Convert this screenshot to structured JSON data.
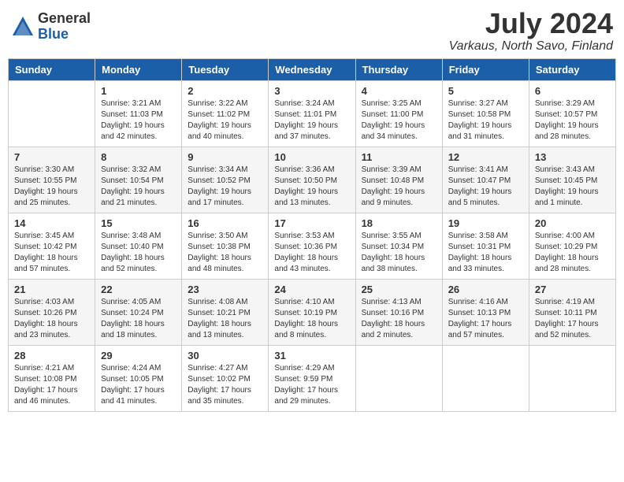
{
  "logo": {
    "general": "General",
    "blue": "Blue"
  },
  "title": {
    "month_year": "July 2024",
    "location": "Varkaus, North Savo, Finland"
  },
  "days_of_week": [
    "Sunday",
    "Monday",
    "Tuesday",
    "Wednesday",
    "Thursday",
    "Friday",
    "Saturday"
  ],
  "weeks": [
    [
      {
        "day": "",
        "detail": ""
      },
      {
        "day": "1",
        "detail": "Sunrise: 3:21 AM\nSunset: 11:03 PM\nDaylight: 19 hours\nand 42 minutes."
      },
      {
        "day": "2",
        "detail": "Sunrise: 3:22 AM\nSunset: 11:02 PM\nDaylight: 19 hours\nand 40 minutes."
      },
      {
        "day": "3",
        "detail": "Sunrise: 3:24 AM\nSunset: 11:01 PM\nDaylight: 19 hours\nand 37 minutes."
      },
      {
        "day": "4",
        "detail": "Sunrise: 3:25 AM\nSunset: 11:00 PM\nDaylight: 19 hours\nand 34 minutes."
      },
      {
        "day": "5",
        "detail": "Sunrise: 3:27 AM\nSunset: 10:58 PM\nDaylight: 19 hours\nand 31 minutes."
      },
      {
        "day": "6",
        "detail": "Sunrise: 3:29 AM\nSunset: 10:57 PM\nDaylight: 19 hours\nand 28 minutes."
      }
    ],
    [
      {
        "day": "7",
        "detail": "Sunrise: 3:30 AM\nSunset: 10:55 PM\nDaylight: 19 hours\nand 25 minutes."
      },
      {
        "day": "8",
        "detail": "Sunrise: 3:32 AM\nSunset: 10:54 PM\nDaylight: 19 hours\nand 21 minutes."
      },
      {
        "day": "9",
        "detail": "Sunrise: 3:34 AM\nSunset: 10:52 PM\nDaylight: 19 hours\nand 17 minutes."
      },
      {
        "day": "10",
        "detail": "Sunrise: 3:36 AM\nSunset: 10:50 PM\nDaylight: 19 hours\nand 13 minutes."
      },
      {
        "day": "11",
        "detail": "Sunrise: 3:39 AM\nSunset: 10:48 PM\nDaylight: 19 hours\nand 9 minutes."
      },
      {
        "day": "12",
        "detail": "Sunrise: 3:41 AM\nSunset: 10:47 PM\nDaylight: 19 hours\nand 5 minutes."
      },
      {
        "day": "13",
        "detail": "Sunrise: 3:43 AM\nSunset: 10:45 PM\nDaylight: 19 hours\nand 1 minute."
      }
    ],
    [
      {
        "day": "14",
        "detail": "Sunrise: 3:45 AM\nSunset: 10:42 PM\nDaylight: 18 hours\nand 57 minutes."
      },
      {
        "day": "15",
        "detail": "Sunrise: 3:48 AM\nSunset: 10:40 PM\nDaylight: 18 hours\nand 52 minutes."
      },
      {
        "day": "16",
        "detail": "Sunrise: 3:50 AM\nSunset: 10:38 PM\nDaylight: 18 hours\nand 48 minutes."
      },
      {
        "day": "17",
        "detail": "Sunrise: 3:53 AM\nSunset: 10:36 PM\nDaylight: 18 hours\nand 43 minutes."
      },
      {
        "day": "18",
        "detail": "Sunrise: 3:55 AM\nSunset: 10:34 PM\nDaylight: 18 hours\nand 38 minutes."
      },
      {
        "day": "19",
        "detail": "Sunrise: 3:58 AM\nSunset: 10:31 PM\nDaylight: 18 hours\nand 33 minutes."
      },
      {
        "day": "20",
        "detail": "Sunrise: 4:00 AM\nSunset: 10:29 PM\nDaylight: 18 hours\nand 28 minutes."
      }
    ],
    [
      {
        "day": "21",
        "detail": "Sunrise: 4:03 AM\nSunset: 10:26 PM\nDaylight: 18 hours\nand 23 minutes."
      },
      {
        "day": "22",
        "detail": "Sunrise: 4:05 AM\nSunset: 10:24 PM\nDaylight: 18 hours\nand 18 minutes."
      },
      {
        "day": "23",
        "detail": "Sunrise: 4:08 AM\nSunset: 10:21 PM\nDaylight: 18 hours\nand 13 minutes."
      },
      {
        "day": "24",
        "detail": "Sunrise: 4:10 AM\nSunset: 10:19 PM\nDaylight: 18 hours\nand 8 minutes."
      },
      {
        "day": "25",
        "detail": "Sunrise: 4:13 AM\nSunset: 10:16 PM\nDaylight: 18 hours\nand 2 minutes."
      },
      {
        "day": "26",
        "detail": "Sunrise: 4:16 AM\nSunset: 10:13 PM\nDaylight: 17 hours\nand 57 minutes."
      },
      {
        "day": "27",
        "detail": "Sunrise: 4:19 AM\nSunset: 10:11 PM\nDaylight: 17 hours\nand 52 minutes."
      }
    ],
    [
      {
        "day": "28",
        "detail": "Sunrise: 4:21 AM\nSunset: 10:08 PM\nDaylight: 17 hours\nand 46 minutes."
      },
      {
        "day": "29",
        "detail": "Sunrise: 4:24 AM\nSunset: 10:05 PM\nDaylight: 17 hours\nand 41 minutes."
      },
      {
        "day": "30",
        "detail": "Sunrise: 4:27 AM\nSunset: 10:02 PM\nDaylight: 17 hours\nand 35 minutes."
      },
      {
        "day": "31",
        "detail": "Sunrise: 4:29 AM\nSunset: 9:59 PM\nDaylight: 17 hours\nand 29 minutes."
      },
      {
        "day": "",
        "detail": ""
      },
      {
        "day": "",
        "detail": ""
      },
      {
        "day": "",
        "detail": ""
      }
    ]
  ]
}
